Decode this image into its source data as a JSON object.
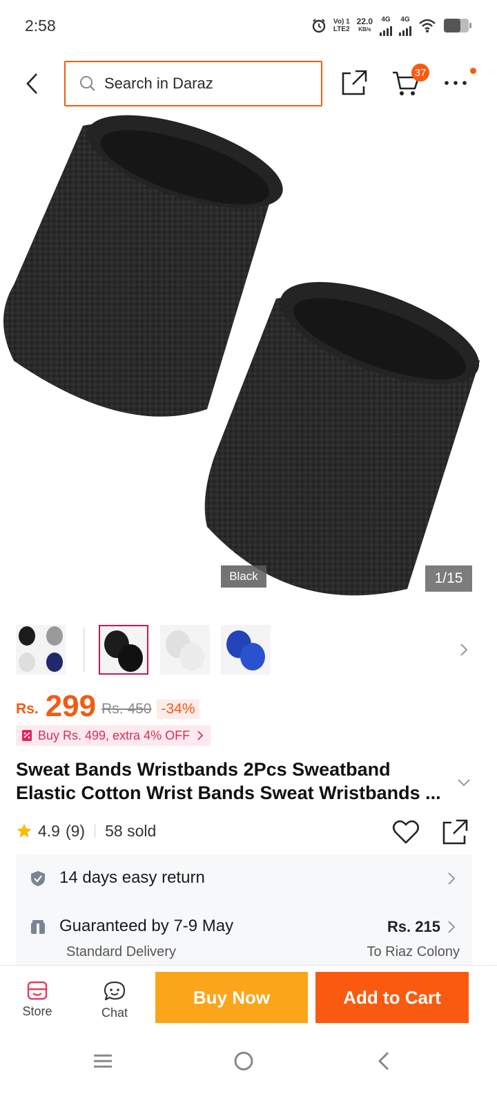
{
  "status_bar": {
    "time": "2:58",
    "volte": "Vo) 1",
    "lte": "LTE2",
    "speed": "22.0",
    "speed_unit": "KB/s",
    "net1": "4G",
    "net2": "4G"
  },
  "header": {
    "search_placeholder": "Search in Daraz",
    "cart_count": "37"
  },
  "product_image": {
    "variant_tag": "Black",
    "counter": "1/15"
  },
  "thumbnails": [
    {
      "name": "thumb-multicolor"
    },
    {
      "name": "thumb-black",
      "selected": true
    },
    {
      "name": "thumb-white"
    },
    {
      "name": "thumb-blue"
    }
  ],
  "price": {
    "currency": "Rs.",
    "current": "299",
    "original": "Rs. 450",
    "discount": "-34%"
  },
  "promo": {
    "text": "Buy Rs. 499, extra 4% OFF"
  },
  "product": {
    "title_line1": "Sweat Bands Wristbands 2Pcs Sweatband",
    "title_line2": "Elastic Cotton Wrist Bands Sweat Wristbands ..."
  },
  "rating": {
    "value": "4.9",
    "count": "(9)",
    "sold": "58 sold"
  },
  "services": {
    "return_text": "14 days easy return",
    "delivery_text": "Guaranteed by 7-9 May",
    "delivery_type": "Standard Delivery",
    "delivery_fee": "Rs. 215",
    "delivery_location": "To Riaz Colony"
  },
  "action_bar": {
    "store_label": "Store",
    "chat_label": "Chat",
    "buy_now_label": "Buy Now",
    "add_to_cart_label": "Add to Cart"
  },
  "colors": {
    "brand_orange": "#fa5a0f",
    "buy_now_yellow": "#fba51a",
    "promo_pink": "#d32f5c"
  }
}
